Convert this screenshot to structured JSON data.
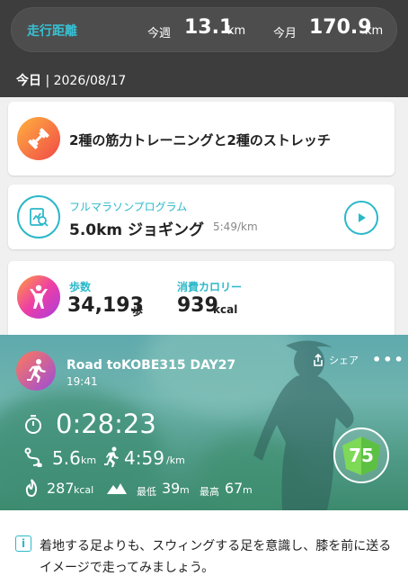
{
  "distance": {
    "title": "走行距離",
    "week_label": "今週",
    "week_value": "13.1",
    "week_unit": "km",
    "month_label": "今月",
    "month_value": "170.9",
    "month_unit": "km"
  },
  "today": {
    "label": "今日",
    "date": "| 2026/08/17"
  },
  "workout_card": {
    "text": "2種の筋力トレーニングと2種のストレッチ",
    "icon": "dumbbell-icon"
  },
  "program_card": {
    "subtitle": "フルマラソンプログラム",
    "title": "5.0km ジョギング",
    "pace": "5:49/km",
    "icon": "chart-search-icon"
  },
  "stats_card": {
    "steps_label": "歩数",
    "steps_value": "34,193",
    "steps_unit": "歩",
    "calories_label": "消費カロリー",
    "calories_value": "939",
    "calories_unit": "kcal",
    "icon": "person-arms-up-icon"
  },
  "activity": {
    "title": "Road toKOBE315 DAY27",
    "time": "19:41",
    "share_label": "シェア",
    "duration": "0:28:23",
    "distance_value": "5.6",
    "distance_unit": "km",
    "pace_value": "4:59",
    "pace_unit": "/km",
    "calories_value": "287",
    "calories_unit": "kcal",
    "min_label": "最低",
    "min_elev_value": "39",
    "min_elev_unit": "m",
    "max_label": "最高",
    "max_elev_value": "67",
    "max_elev_unit": "m",
    "score": "75"
  },
  "tip": {
    "text": "着地する足よりも、スウィングする足を意識し、膝を前に送るイメージで走ってみましょう。"
  },
  "colors": {
    "accent": "#2bb8c9",
    "header_bg": "#3d3d3d",
    "score_green": "#7ed957"
  }
}
